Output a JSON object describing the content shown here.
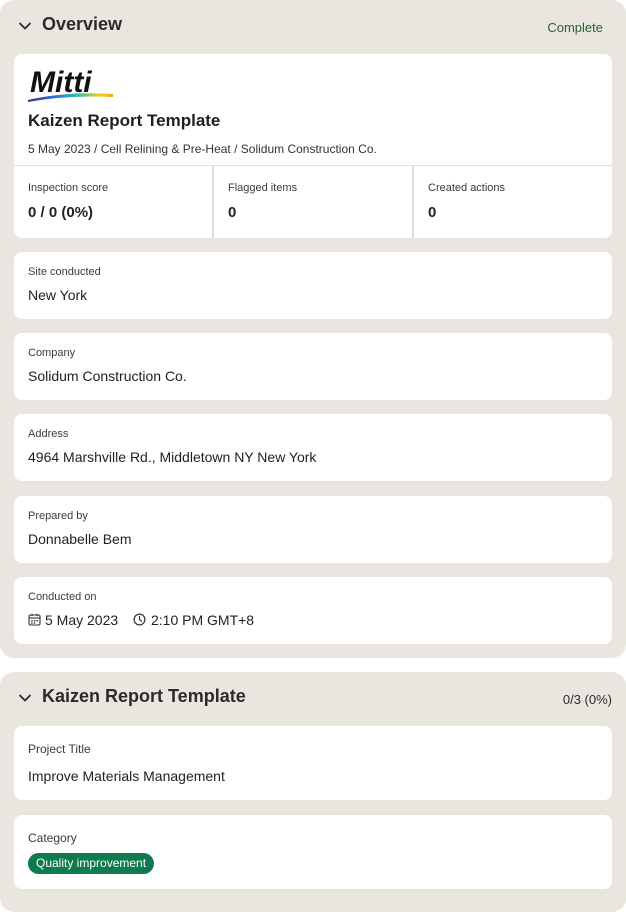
{
  "overview": {
    "title": "Overview",
    "status": "Complete",
    "logo_text": "Mitti",
    "report_title": "Kaizen Report Template",
    "report_subtitle": "5 May 2023 / Cell Relining & Pre-Heat / Solidum Construction Co.",
    "stats": [
      {
        "label": "Inspection score",
        "value": "0 / 0 (0%)"
      },
      {
        "label": "Flagged items",
        "value": "0"
      },
      {
        "label": "Created actions",
        "value": "0"
      }
    ],
    "fields": [
      {
        "label": "Site conducted",
        "value": "New York"
      },
      {
        "label": "Company",
        "value": "Solidum Construction Co."
      },
      {
        "label": "Address",
        "value": "4964 Marshville Rd., Middletown NY New York"
      },
      {
        "label": "Prepared by",
        "value": "Donnabelle Bem"
      }
    ],
    "conducted": {
      "label": "Conducted on",
      "date": "5 May 2023",
      "time": "2:10 PM GMT+8",
      "date_icon": "calendar-icon",
      "time_icon": "clock-icon"
    }
  },
  "kaizen": {
    "title": "Kaizen Report Template",
    "progress": "0/3 (0%)",
    "project_title_label": "Project Title",
    "project_title_value": "Improve Materials Management",
    "category_label": "Category",
    "category_value": "Quality improvement"
  },
  "colors": {
    "section_bg": "#e9e6e0",
    "status_green": "#2f5e2e",
    "badge_green": "#0e7a4e"
  }
}
